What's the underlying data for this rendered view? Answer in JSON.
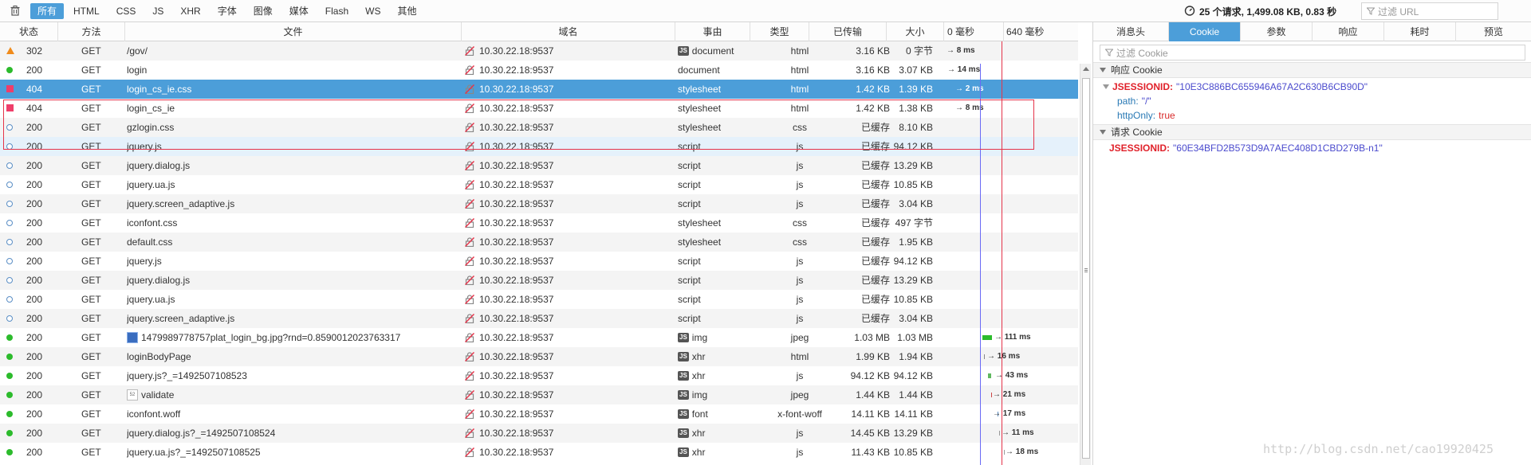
{
  "toolbar": {
    "filters": [
      "所有",
      "HTML",
      "CSS",
      "JS",
      "XHR",
      "字体",
      "图像",
      "媒体",
      "Flash",
      "WS",
      "其他"
    ],
    "summary": "25 个请求, 1,499.08 KB, 0.83 秒",
    "filter_url_placeholder": "过滤 URL"
  },
  "table": {
    "headers": {
      "status": "状态",
      "method": "方法",
      "file": "文件",
      "domain": "域名",
      "cause": "事由",
      "type": "类型",
      "transferred": "已传输",
      "size": "大小",
      "timeline_0": "0 毫秒",
      "timeline_640": "640 毫秒"
    },
    "rows": [
      {
        "icon": "redirect",
        "status": "302",
        "method": "GET",
        "file": "/gov/",
        "domain": "10.30.22.18:9537",
        "cause": "document",
        "cause_js": true,
        "type": "html",
        "transferred": "3.16 KB",
        "size": "0 字节",
        "timing": "→ 8 ms"
      },
      {
        "icon": "ok",
        "status": "200",
        "method": "GET",
        "file": "login",
        "domain": "10.30.22.18:9537",
        "cause": "document",
        "cause_js": false,
        "type": "html",
        "transferred": "3.16 KB",
        "size": "3.07 KB",
        "timing": "→ 14 ms"
      },
      {
        "icon": "error",
        "status": "404",
        "method": "GET",
        "file": "login_cs_ie.css",
        "domain": "10.30.22.18:9537",
        "cause": "stylesheet",
        "cause_js": false,
        "type": "html",
        "transferred": "1.42 KB",
        "size": "1.39 KB",
        "timing": "→ 2 ms"
      },
      {
        "icon": "error",
        "status": "404",
        "method": "GET",
        "file": "login_cs_ie",
        "domain": "10.30.22.18:9537",
        "cause": "stylesheet",
        "cause_js": false,
        "type": "html",
        "transferred": "1.42 KB",
        "size": "1.38 KB",
        "timing": "→ 8 ms"
      },
      {
        "icon": "cached",
        "status": "200",
        "method": "GET",
        "file": "gzlogin.css",
        "domain": "10.30.22.18:9537",
        "cause": "stylesheet",
        "cause_js": false,
        "type": "css",
        "transferred": "已缓存",
        "size": "8.10 KB",
        "timing": ""
      },
      {
        "icon": "cached",
        "status": "200",
        "method": "GET",
        "file": "jquery.js",
        "domain": "10.30.22.18:9537",
        "cause": "script",
        "cause_js": false,
        "type": "js",
        "transferred": "已缓存",
        "size": "94.12 KB",
        "timing": ""
      },
      {
        "icon": "cached",
        "status": "200",
        "method": "GET",
        "file": "jquery.dialog.js",
        "domain": "10.30.22.18:9537",
        "cause": "script",
        "cause_js": false,
        "type": "js",
        "transferred": "已缓存",
        "size": "13.29 KB",
        "timing": ""
      },
      {
        "icon": "cached",
        "status": "200",
        "method": "GET",
        "file": "jquery.ua.js",
        "domain": "10.30.22.18:9537",
        "cause": "script",
        "cause_js": false,
        "type": "js",
        "transferred": "已缓存",
        "size": "10.85 KB",
        "timing": ""
      },
      {
        "icon": "cached",
        "status": "200",
        "method": "GET",
        "file": "jquery.screen_adaptive.js",
        "domain": "10.30.22.18:9537",
        "cause": "script",
        "cause_js": false,
        "type": "js",
        "transferred": "已缓存",
        "size": "3.04 KB",
        "timing": ""
      },
      {
        "icon": "cached",
        "status": "200",
        "method": "GET",
        "file": "iconfont.css",
        "domain": "10.30.22.18:9537",
        "cause": "stylesheet",
        "cause_js": false,
        "type": "css",
        "transferred": "已缓存",
        "size": "497 字节",
        "timing": ""
      },
      {
        "icon": "cached",
        "status": "200",
        "method": "GET",
        "file": "default.css",
        "domain": "10.30.22.18:9537",
        "cause": "stylesheet",
        "cause_js": false,
        "type": "css",
        "transferred": "已缓存",
        "size": "1.95 KB",
        "timing": ""
      },
      {
        "icon": "cached",
        "status": "200",
        "method": "GET",
        "file": "jquery.js",
        "domain": "10.30.22.18:9537",
        "cause": "script",
        "cause_js": false,
        "type": "js",
        "transferred": "已缓存",
        "size": "94.12 KB",
        "timing": ""
      },
      {
        "icon": "cached",
        "status": "200",
        "method": "GET",
        "file": "jquery.dialog.js",
        "domain": "10.30.22.18:9537",
        "cause": "script",
        "cause_js": false,
        "type": "js",
        "transferred": "已缓存",
        "size": "13.29 KB",
        "timing": ""
      },
      {
        "icon": "cached",
        "status": "200",
        "method": "GET",
        "file": "jquery.ua.js",
        "domain": "10.30.22.18:9537",
        "cause": "script",
        "cause_js": false,
        "type": "js",
        "transferred": "已缓存",
        "size": "10.85 KB",
        "timing": ""
      },
      {
        "icon": "cached",
        "status": "200",
        "method": "GET",
        "file": "jquery.screen_adaptive.js",
        "domain": "10.30.22.18:9537",
        "cause": "script",
        "cause_js": false,
        "type": "js",
        "transferred": "已缓存",
        "size": "3.04 KB",
        "timing": ""
      },
      {
        "icon": "ok",
        "status": "200",
        "method": "GET",
        "file": "1479989778757plat_login_bg.jpg?rnd=0.8590012023763317",
        "file_thumb": "image",
        "domain": "10.30.22.18:9537",
        "cause": "img",
        "cause_js": true,
        "type": "jpeg",
        "transferred": "1.03 MB",
        "size": "1.03 MB",
        "timing": "→ 111 ms"
      },
      {
        "icon": "ok",
        "status": "200",
        "method": "GET",
        "file": "loginBodyPage",
        "domain": "10.30.22.18:9537",
        "cause": "xhr",
        "cause_js": true,
        "type": "html",
        "transferred": "1.99 KB",
        "size": "1.94 KB",
        "timing": "→ 16 ms"
      },
      {
        "icon": "ok",
        "status": "200",
        "method": "GET",
        "file": "jquery.js?_=1492507108523",
        "domain": "10.30.22.18:9537",
        "cause": "xhr",
        "cause_js": true,
        "type": "js",
        "transferred": "94.12 KB",
        "size": "94.12 KB",
        "timing": "→ 43 ms"
      },
      {
        "icon": "ok",
        "status": "200",
        "method": "GET",
        "file": "validate",
        "file_thumb": "small",
        "domain": "10.30.22.18:9537",
        "cause": "img",
        "cause_js": true,
        "type": "jpeg",
        "transferred": "1.44 KB",
        "size": "1.44 KB",
        "timing": "→ 21 ms"
      },
      {
        "icon": "ok",
        "status": "200",
        "method": "GET",
        "file": "iconfont.woff",
        "domain": "10.30.22.18:9537",
        "cause": "font",
        "cause_js": true,
        "type": "x-font-woff",
        "transferred": "14.11 KB",
        "size": "14.11 KB",
        "timing": "→ 17 ms"
      },
      {
        "icon": "ok",
        "status": "200",
        "method": "GET",
        "file": "jquery.dialog.js?_=1492507108524",
        "domain": "10.30.22.18:9537",
        "cause": "xhr",
        "cause_js": true,
        "type": "js",
        "transferred": "14.45 KB",
        "size": "13.29 KB",
        "timing": "→ 11 ms"
      },
      {
        "icon": "ok",
        "status": "200",
        "method": "GET",
        "file": "jquery.ua.js?_=1492507108525",
        "domain": "10.30.22.18:9537",
        "cause": "xhr",
        "cause_js": true,
        "type": "js",
        "transferred": "11.43 KB",
        "size": "10.85 KB",
        "timing": "→ 18 ms"
      }
    ]
  },
  "details": {
    "tabs": [
      "消息头",
      "Cookie",
      "参数",
      "响应",
      "耗时",
      "预览"
    ],
    "active_tab": "Cookie",
    "cookie_filter_placeholder": "过滤 Cookie",
    "response_section": "响应 Cookie",
    "response_cookie_name": "JSESSIONID:",
    "response_cookie_value": "\"10E3C886BC655946A67A2C630B6CB90D\"",
    "path_key": "path:",
    "path_value": "\"/\"",
    "httponly_key": "httpOnly:",
    "httponly_value": "true",
    "request_section": "请求 Cookie",
    "request_cookie_name": "JSESSIONID:",
    "request_cookie_value": "\"60E34BFD2B573D9A7AEC408D1CBD279B-n1\""
  },
  "watermark": "http://blog.csdn.net/cao19920425",
  "colors": {
    "selected": "#4c9ed9",
    "status_ok": "#2cbb2c",
    "status_error": "#ef3e6a",
    "status_redirect": "#f08b1b",
    "cookie_name": "#e0212a",
    "cookie_value": "#4a4acd"
  }
}
